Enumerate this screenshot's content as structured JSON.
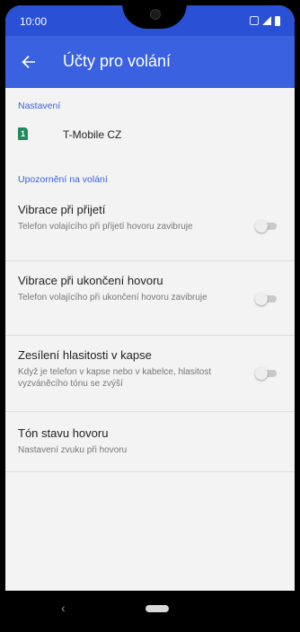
{
  "status_bar": {
    "time": "10:00",
    "icons": [
      "nfc-icon",
      "signal-icon",
      "battery-icon"
    ]
  },
  "app_bar": {
    "back_icon": "arrow-back-icon",
    "title": "Účty pro volání"
  },
  "sections": {
    "settings_header": "Nastavení",
    "account": {
      "icon": "sim-card-icon",
      "sim_number": "1",
      "label": "T-Mobile CZ"
    },
    "notifications_header": "Upozornění na volání"
  },
  "settings": [
    {
      "title": "Vibrace při přijetí",
      "description": "Telefon volajícího při přijetí hovoru zavibruje",
      "enabled": false
    },
    {
      "title": "Vibrace při ukončení hovoru",
      "description": "Telefon volajícího při ukončení hovoru zavibruje",
      "enabled": false
    },
    {
      "title": "Zesílení hlasitosti v kapse",
      "description": "Když je telefon v kapse nebo v kabelce, hlasitost vyzváněcího tónu se zvýší",
      "enabled": false
    },
    {
      "title": "Tón stavu hovoru",
      "description": "Nastavení zvuku při hovoru"
    }
  ],
  "nav_bar": {
    "back_icon": "nav-back-icon",
    "home_icon": "home-pill-icon"
  },
  "colors": {
    "status_bar": "#2a50d6",
    "app_bar": "#3a61e0",
    "accent": "#3a61e0",
    "background": "#f3f3f3"
  }
}
